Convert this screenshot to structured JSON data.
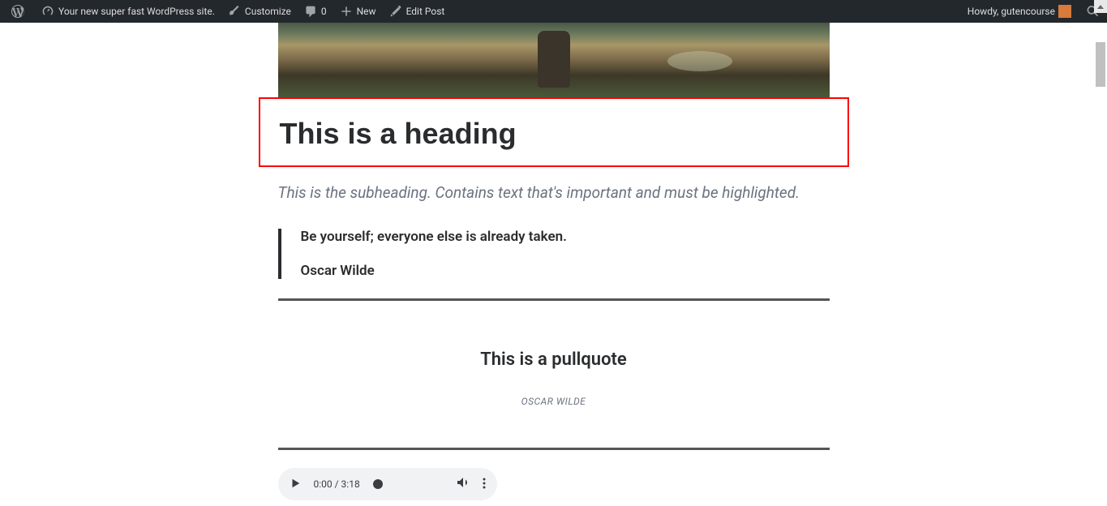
{
  "adminBar": {
    "siteTitle": "Your new super fast WordPress site.",
    "customize": "Customize",
    "commentCount": "0",
    "new": "New",
    "editPost": "Edit Post",
    "greeting": "Howdy, gutencourse"
  },
  "content": {
    "heading": "This is a heading",
    "subheading": "This is the subheading. Contains text that's important and must be highlighted.",
    "blockquote": {
      "text": "Be yourself; everyone else is already taken.",
      "author": "Oscar Wilde"
    },
    "pullquote": {
      "text": "This is a pullquote",
      "author": "OSCAR WILDE"
    },
    "audio": {
      "time": "0:00 / 3:18"
    }
  }
}
